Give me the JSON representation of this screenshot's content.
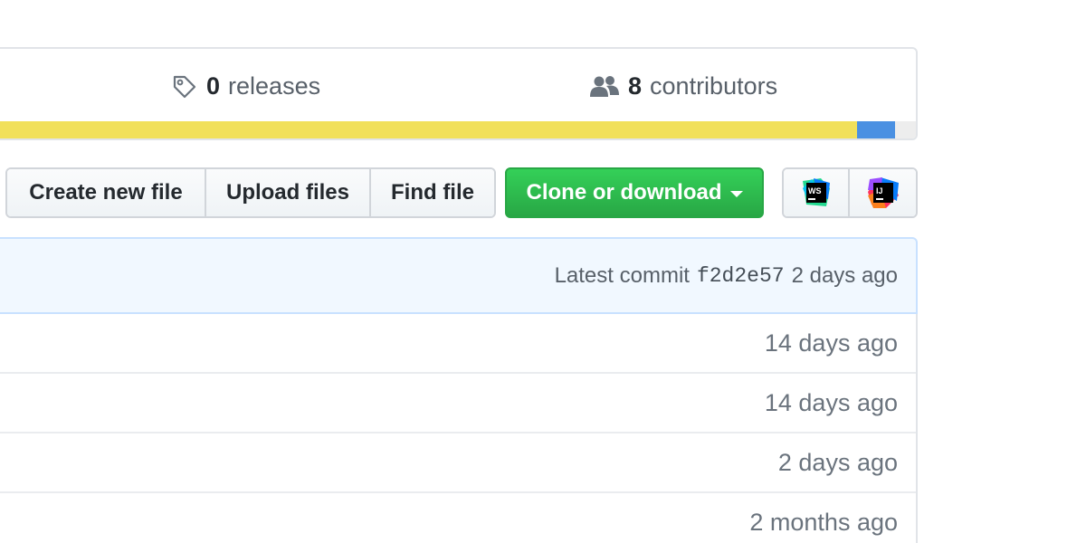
{
  "stats": {
    "releases": {
      "count": "0",
      "label": "releases",
      "icon": "tag-icon"
    },
    "contributors": {
      "count": "8",
      "label": "contributors",
      "icon": "people-icon"
    }
  },
  "languages": [
    {
      "color": "#f1e05a",
      "percent": 94.3
    },
    {
      "color": "#4a90e2",
      "percent": 4.1
    },
    {
      "color": "#ededed",
      "percent": 2.3
    }
  ],
  "toolbar": {
    "create_label": "Create new file",
    "upload_label": "Upload files",
    "find_label": "Find file",
    "clone_label": "Clone or download",
    "ide_buttons": [
      "webstorm-icon",
      "intellij-icon"
    ]
  },
  "commit": {
    "prefix": "Latest commit",
    "sha": "f2d2e57",
    "time": "2 days ago"
  },
  "files": [
    {
      "age": "14 days ago"
    },
    {
      "age": "14 days ago"
    },
    {
      "age": "2 days ago"
    },
    {
      "age": "2 months ago"
    }
  ],
  "colors": {
    "accent_green": "#28a745",
    "language_yellow": "#f1e05a",
    "language_blue": "#4a90e2"
  }
}
